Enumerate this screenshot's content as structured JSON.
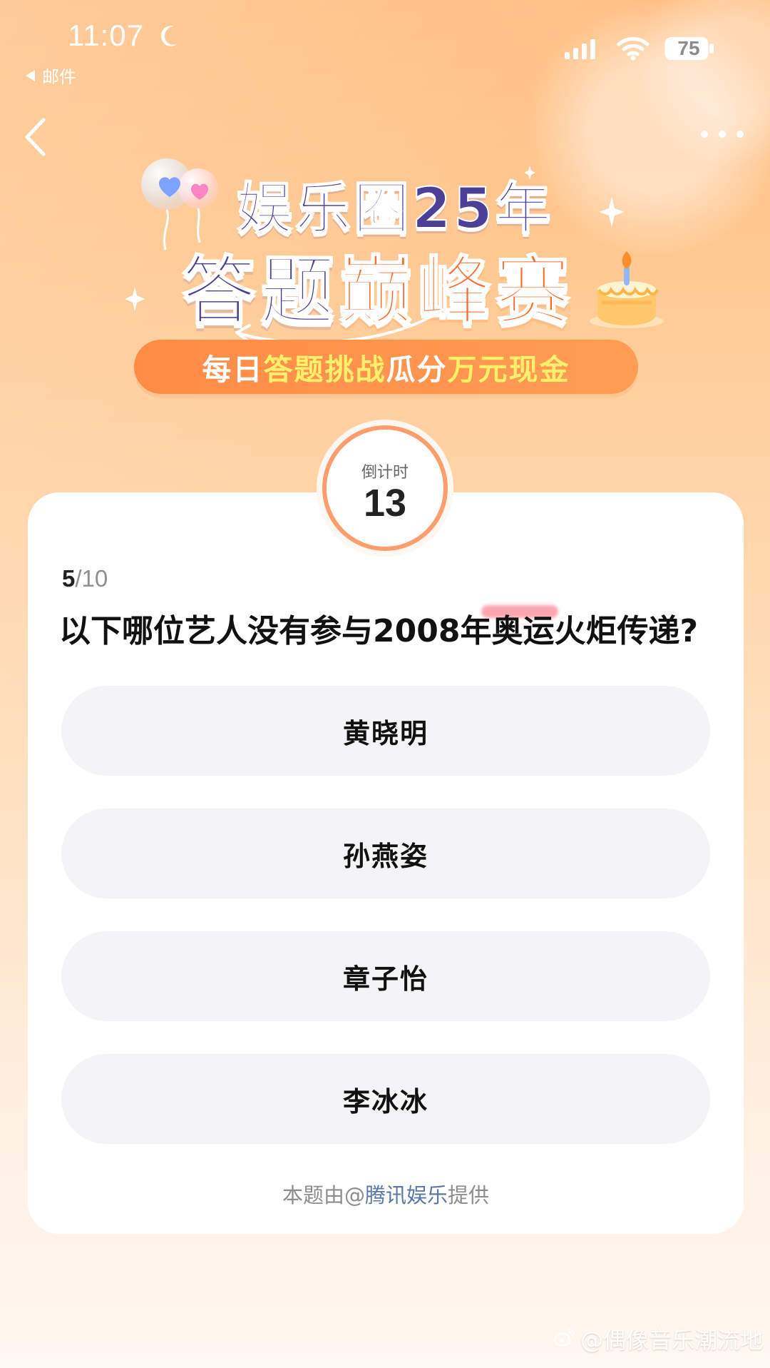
{
  "status_bar": {
    "time": "11:07",
    "back_app_label": "邮件",
    "battery_level": "75"
  },
  "banner": {
    "title_line_1": "娱乐圈25年",
    "title_line_2_part_1": "答题",
    "title_line_2_part_2": "巅峰赛",
    "subtitle_part_1": "每日",
    "subtitle_part_2": "答题挑战",
    "subtitle_part_3": " 瓜分",
    "subtitle_part_4": "万元现金"
  },
  "countdown": {
    "label": "倒计时",
    "value": "13"
  },
  "question": {
    "progress_current": "5",
    "progress_total": "/10",
    "text": "以下哪位艺人没有参与2008年奥运火炬传递?",
    "options": [
      {
        "label": "黄晓明"
      },
      {
        "label": "孙燕姿"
      },
      {
        "label": "章子怡"
      },
      {
        "label": "李冰冰"
      }
    ],
    "source_prefix": "本题由@",
    "source_name": "腾讯娱乐",
    "source_suffix": "提供"
  },
  "watermark": {
    "text": "@偶像音乐潮流地"
  },
  "icons": {
    "moon": "moon-icon",
    "signal": "signal-icon",
    "wifi": "wifi-icon",
    "battery": "battery-icon",
    "back": "chevron-left-icon",
    "more": "more-icon",
    "balloons": "balloons-icon",
    "cake": "cake-icon",
    "star": "sparkle-icon",
    "weibo": "weibo-icon"
  },
  "colors": {
    "accent_orange": "#ff6a2b",
    "accent_purple": "#4a3f95",
    "countdown_ring": "#ff9d6d",
    "option_background": "#f4f4f6",
    "source_link": "#5a78a8"
  }
}
